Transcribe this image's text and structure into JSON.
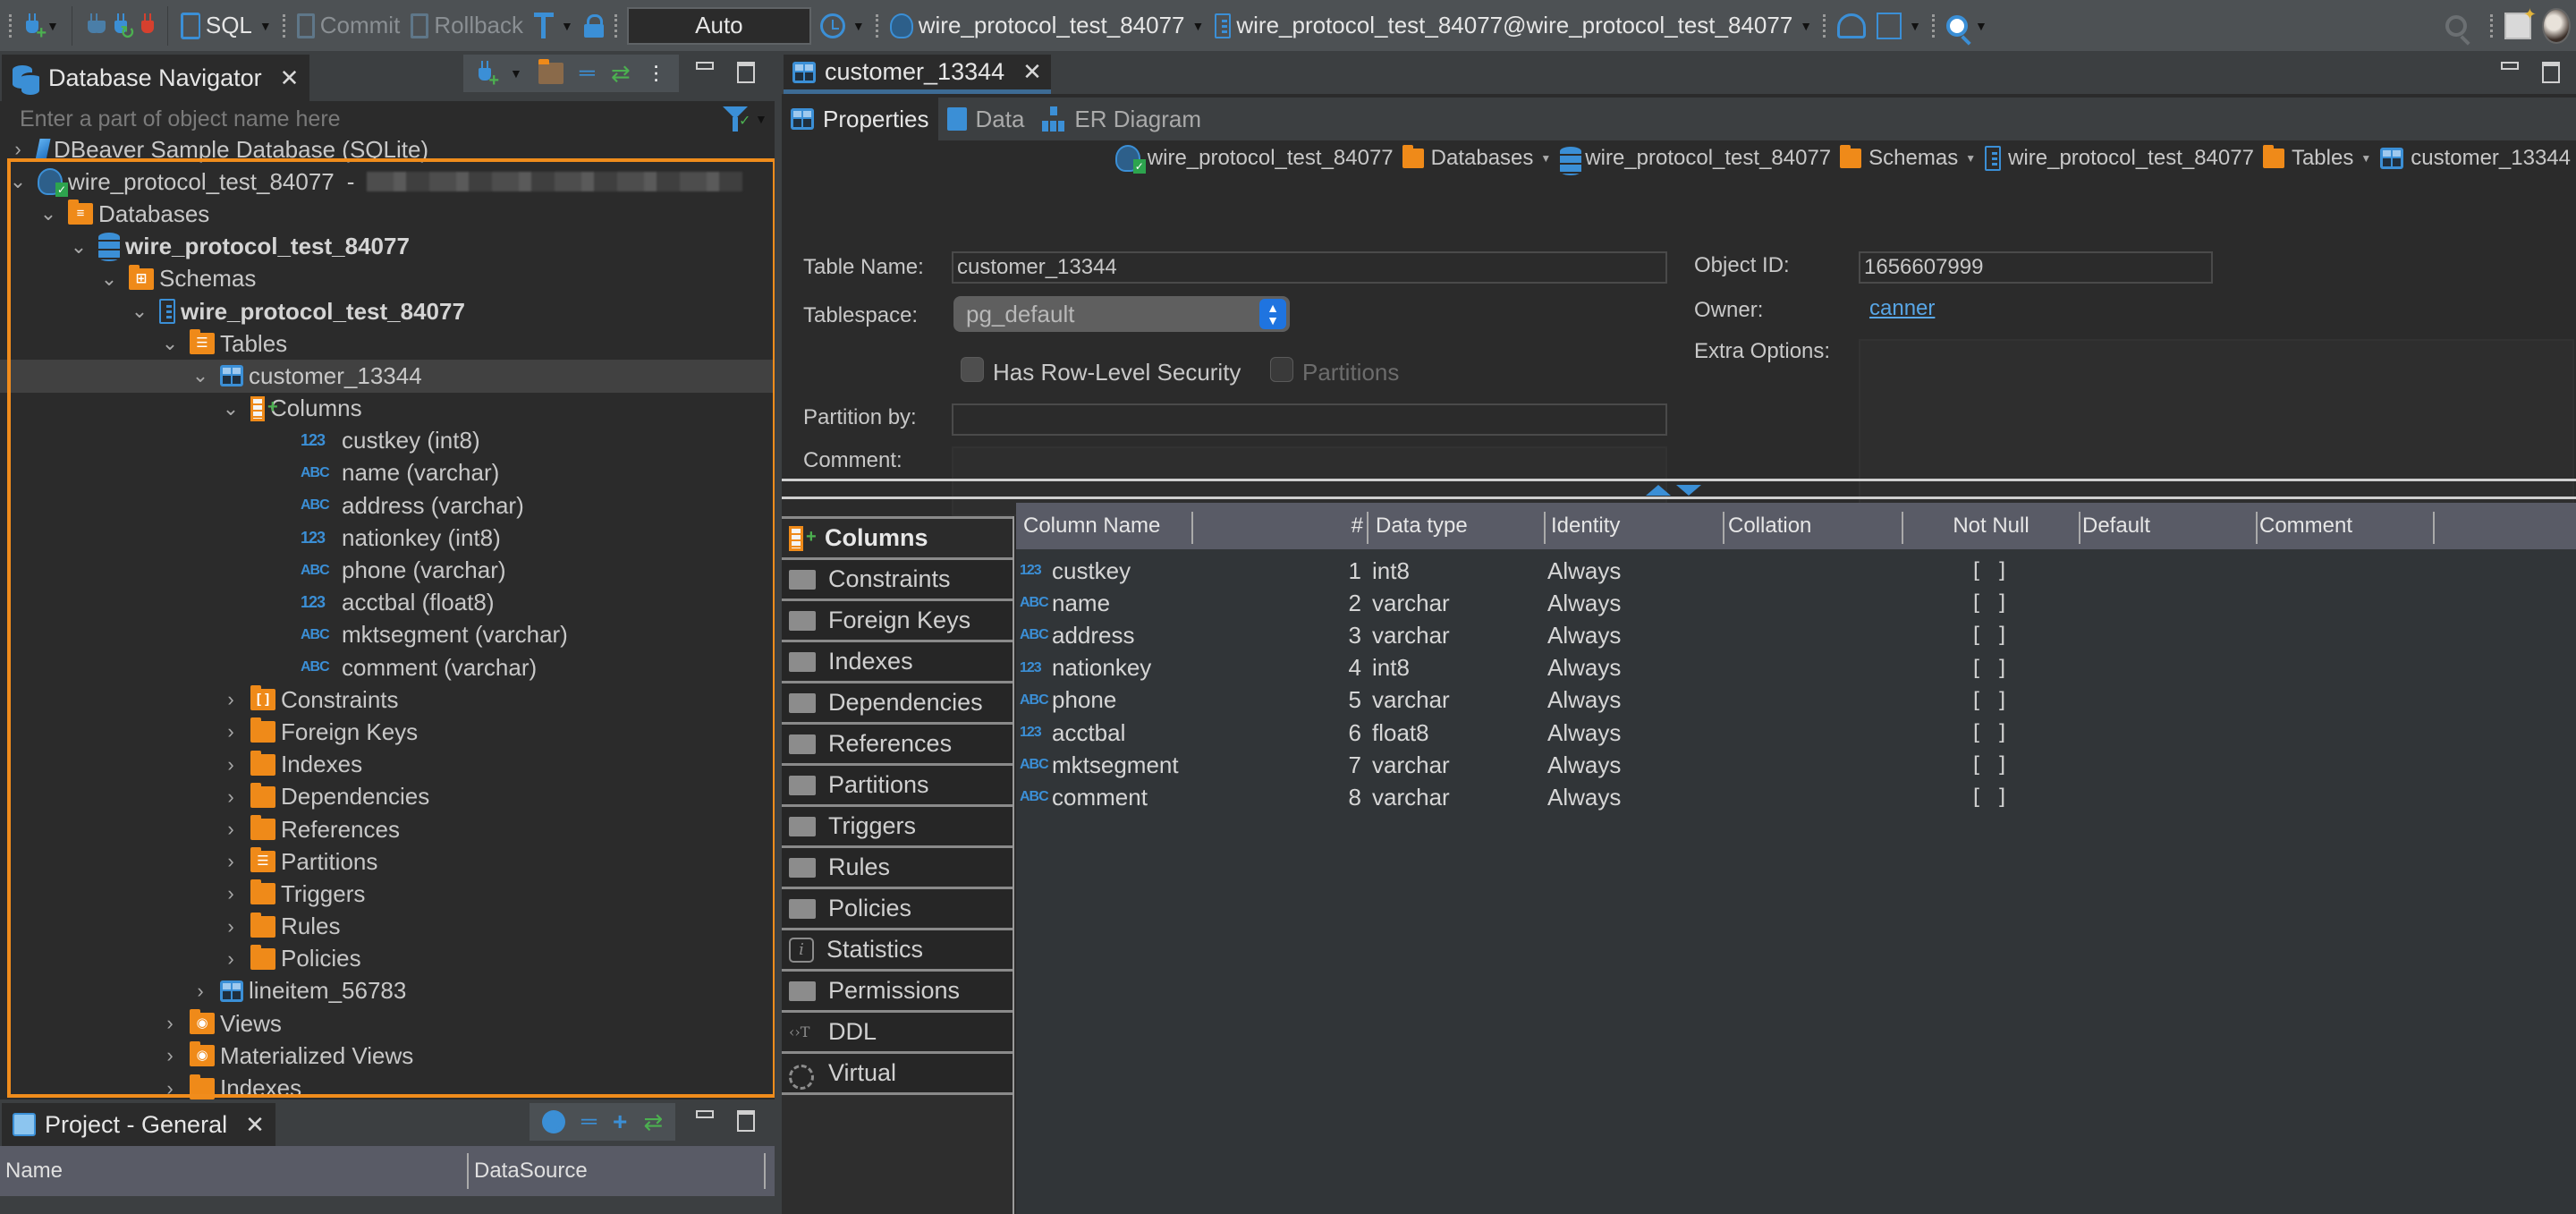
{
  "toolbar": {
    "sql_label": "SQL",
    "commit_label": "Commit",
    "rollback_label": "Rollback",
    "transaction_mode": "Auto",
    "active_datasource": "wire_protocol_test_84077",
    "active_schema": "wire_protocol_test_84077@wire_protocol_test_84077",
    "icons": [
      "new-connection-icon",
      "connect-icon",
      "reconnect-icon",
      "disconnect-icon",
      "sql-editor-icon",
      "commit-icon",
      "rollback-icon",
      "transaction-mode-icon",
      "lock-icon",
      "history-icon",
      "postgres-icon",
      "schema-icon",
      "dashboard-icon",
      "boxes-icon",
      "search-icon",
      "global-search-icon",
      "perspective-icon",
      "avatar-icon"
    ]
  },
  "navigator": {
    "title": "Database Navigator",
    "filter_placeholder": "Enter a part of object name here",
    "tree": [
      {
        "label": "DBeaver Sample Database (SQLite)",
        "icon": "sqlite-icon",
        "depth": 0,
        "expanded": false
      },
      {
        "label": "wire_protocol_test_84077",
        "suffix": "-",
        "icon": "postgres-connection-icon",
        "depth": 0,
        "expanded": true,
        "blurred_detail": true
      },
      {
        "label": "Databases",
        "icon": "databases-folder-icon",
        "depth": 1,
        "expanded": true
      },
      {
        "label": "wire_protocol_test_84077",
        "icon": "database-icon",
        "depth": 2,
        "expanded": true,
        "bold": true
      },
      {
        "label": "Schemas",
        "icon": "schemas-folder-icon",
        "depth": 3,
        "expanded": true
      },
      {
        "label": "wire_protocol_test_84077",
        "icon": "schema-icon",
        "depth": 4,
        "expanded": true,
        "bold": true
      },
      {
        "label": "Tables",
        "icon": "tables-folder-icon",
        "depth": 5,
        "expanded": true
      },
      {
        "label": "customer_13344",
        "icon": "table-icon",
        "depth": 6,
        "expanded": true,
        "selected": true
      },
      {
        "label": "Columns",
        "icon": "columns-icon",
        "depth": 7,
        "expanded": true
      },
      {
        "label": "custkey (int8)",
        "icon": "type-123",
        "depth": 8,
        "leaf": true
      },
      {
        "label": "name (varchar)",
        "icon": "type-abc",
        "depth": 8,
        "leaf": true
      },
      {
        "label": "address (varchar)",
        "icon": "type-abc",
        "depth": 8,
        "leaf": true
      },
      {
        "label": "nationkey (int8)",
        "icon": "type-123",
        "depth": 8,
        "leaf": true
      },
      {
        "label": "phone (varchar)",
        "icon": "type-abc",
        "depth": 8,
        "leaf": true
      },
      {
        "label": "acctbal (float8)",
        "icon": "type-123",
        "depth": 8,
        "leaf": true
      },
      {
        "label": "mktsegment (varchar)",
        "icon": "type-abc",
        "depth": 8,
        "leaf": true
      },
      {
        "label": "comment (varchar)",
        "icon": "type-abc",
        "depth": 8,
        "leaf": true
      },
      {
        "label": "Constraints",
        "icon": "constraints-folder-icon",
        "depth": 7,
        "expanded": false
      },
      {
        "label": "Foreign Keys",
        "icon": "folder-icon",
        "depth": 7,
        "expanded": false
      },
      {
        "label": "Indexes",
        "icon": "folder-icon",
        "depth": 7,
        "expanded": false
      },
      {
        "label": "Dependencies",
        "icon": "folder-icon",
        "depth": 7,
        "expanded": false
      },
      {
        "label": "References",
        "icon": "folder-icon",
        "depth": 7,
        "expanded": false
      },
      {
        "label": "Partitions",
        "icon": "partitions-folder-icon",
        "depth": 7,
        "expanded": false
      },
      {
        "label": "Triggers",
        "icon": "folder-icon",
        "depth": 7,
        "expanded": false
      },
      {
        "label": "Rules",
        "icon": "folder-icon",
        "depth": 7,
        "expanded": false
      },
      {
        "label": "Policies",
        "icon": "folder-icon",
        "depth": 7,
        "expanded": false
      },
      {
        "label": "lineitem_56783",
        "icon": "table-icon",
        "depth": 6,
        "expanded": false
      },
      {
        "label": "Views",
        "icon": "views-folder-icon",
        "depth": 5,
        "expanded": false
      },
      {
        "label": "Materialized Views",
        "icon": "views-folder-icon",
        "depth": 5,
        "expanded": false
      },
      {
        "label": "Indexes",
        "icon": "folder-icon",
        "depth": 5,
        "expanded": false
      }
    ]
  },
  "project": {
    "title": "Project - General",
    "columns": [
      "Name",
      "DataSource"
    ]
  },
  "editor": {
    "tab_title": "customer_13344",
    "sub_tabs": [
      {
        "label": "Properties",
        "active": true
      },
      {
        "label": "Data",
        "active": false
      },
      {
        "label": "ER Diagram",
        "active": false
      }
    ],
    "breadcrumb": [
      {
        "label": "wire_protocol_test_84077",
        "icon": "postgres-connection-icon",
        "dropdown": false
      },
      {
        "label": "Databases",
        "icon": "databases-folder-icon",
        "dropdown": true
      },
      {
        "label": "wire_protocol_test_84077",
        "icon": "database-icon",
        "dropdown": false
      },
      {
        "label": "Schemas",
        "icon": "schemas-folder-icon",
        "dropdown": true
      },
      {
        "label": "wire_protocol_test_84077",
        "icon": "schema-icon",
        "dropdown": false
      },
      {
        "label": "Tables",
        "icon": "tables-folder-icon",
        "dropdown": true
      },
      {
        "label": "customer_13344",
        "icon": "table-icon",
        "dropdown": false
      }
    ],
    "properties": {
      "table_name_label": "Table Name:",
      "table_name_value": "customer_13344",
      "tablespace_label": "Tablespace:",
      "tablespace_value": "pg_default",
      "rls_label": "Has Row-Level Security",
      "rls_checked": false,
      "partitions_label": "Partitions",
      "partitions_checked": false,
      "partitions_enabled": false,
      "partition_by_label": "Partition by:",
      "partition_by_value": "",
      "comment_label": "Comment:",
      "comment_value": "",
      "object_id_label": "Object ID:",
      "object_id_value": "1656607999",
      "owner_label": "Owner:",
      "owner_value": "canner",
      "extra_options_label": "Extra Options:",
      "extra_options_value": ""
    },
    "side_tabs": [
      {
        "label": "Columns",
        "icon": "columns-icon",
        "active": true
      },
      {
        "label": "Constraints",
        "icon": "constraints-icon"
      },
      {
        "label": "Foreign Keys",
        "icon": "folder-icon"
      },
      {
        "label": "Indexes",
        "icon": "folder-icon"
      },
      {
        "label": "Dependencies",
        "icon": "folder-icon"
      },
      {
        "label": "References",
        "icon": "folder-icon"
      },
      {
        "label": "Partitions",
        "icon": "partitions-icon"
      },
      {
        "label": "Triggers",
        "icon": "folder-icon"
      },
      {
        "label": "Rules",
        "icon": "folder-icon"
      },
      {
        "label": "Policies",
        "icon": "folder-icon"
      },
      {
        "label": "Statistics",
        "icon": "info-icon"
      },
      {
        "label": "Permissions",
        "icon": "permissions-icon"
      },
      {
        "label": "DDL",
        "icon": "ddl-icon"
      },
      {
        "label": "Virtual",
        "icon": "virtual-icon"
      }
    ],
    "columns_grid": {
      "headers": [
        "Column Name",
        "#",
        "Data type",
        "Identity",
        "Collation",
        "Not Null",
        "Default",
        "Comment"
      ],
      "rows": [
        {
          "type_icon": "123",
          "name": "custkey",
          "num": "1",
          "data_type": "int8",
          "identity": "Always",
          "collation": "",
          "not_null": "[ ]",
          "default": "",
          "comment": ""
        },
        {
          "type_icon": "ABC",
          "name": "name",
          "num": "2",
          "data_type": "varchar",
          "identity": "Always",
          "collation": "",
          "not_null": "[ ]",
          "default": "",
          "comment": ""
        },
        {
          "type_icon": "ABC",
          "name": "address",
          "num": "3",
          "data_type": "varchar",
          "identity": "Always",
          "collation": "",
          "not_null": "[ ]",
          "default": "",
          "comment": ""
        },
        {
          "type_icon": "123",
          "name": "nationkey",
          "num": "4",
          "data_type": "int8",
          "identity": "Always",
          "collation": "",
          "not_null": "[ ]",
          "default": "",
          "comment": ""
        },
        {
          "type_icon": "ABC",
          "name": "phone",
          "num": "5",
          "data_type": "varchar",
          "identity": "Always",
          "collation": "",
          "not_null": "[ ]",
          "default": "",
          "comment": ""
        },
        {
          "type_icon": "123",
          "name": "acctbal",
          "num": "6",
          "data_type": "float8",
          "identity": "Always",
          "collation": "",
          "not_null": "[ ]",
          "default": "",
          "comment": ""
        },
        {
          "type_icon": "ABC",
          "name": "mktsegment",
          "num": "7",
          "data_type": "varchar",
          "identity": "Always",
          "collation": "",
          "not_null": "[ ]",
          "default": "",
          "comment": ""
        },
        {
          "type_icon": "ABC",
          "name": "comment",
          "num": "8",
          "data_type": "varchar",
          "identity": "Always",
          "collation": "",
          "not_null": "[ ]",
          "default": "",
          "comment": ""
        }
      ]
    }
  },
  "colors": {
    "accent": "#3b8fd6",
    "highlight_border": "#f08c1c",
    "folder": "#ef8a19",
    "link": "#58a6e6"
  }
}
